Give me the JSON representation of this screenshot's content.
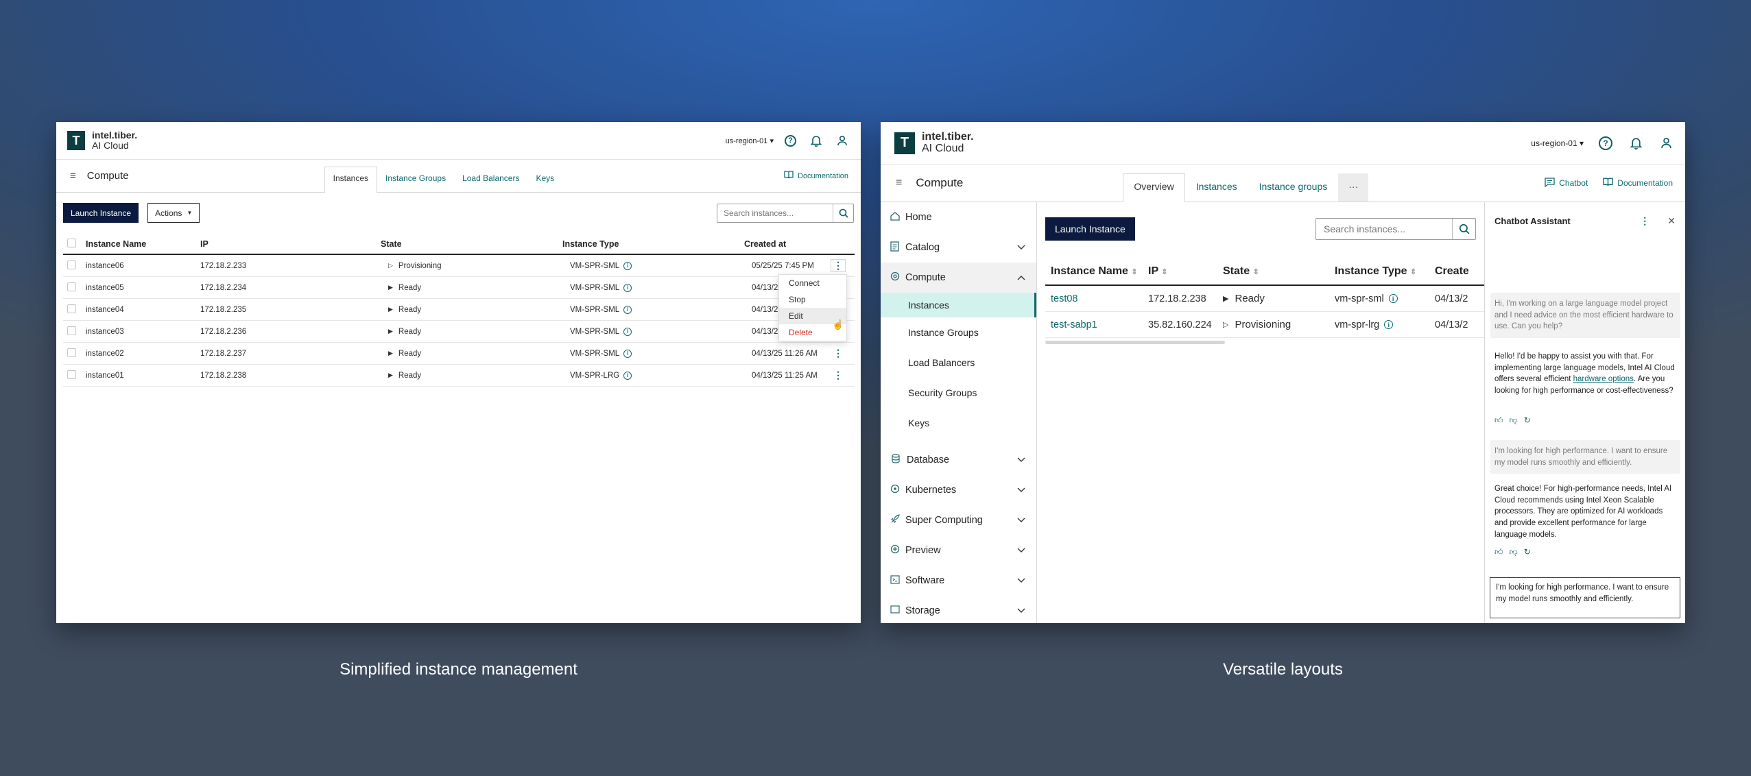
{
  "brand": {
    "line1": "intel.tiber.",
    "line2": "AI Cloud",
    "mark": "T"
  },
  "left": {
    "region": "us-region-01 ▾",
    "page_title": "Compute",
    "tabs": [
      {
        "label": "Instances"
      },
      {
        "label": "Instance Groups"
      },
      {
        "label": "Load Balancers"
      },
      {
        "label": "Keys"
      }
    ],
    "documentation": "Documentation",
    "launch_label": "Launch Instance",
    "actions_label": "Actions",
    "search_placeholder": "Search instances...",
    "columns": {
      "name": "Instance Name",
      "ip": "IP",
      "state": "State",
      "type": "Instance Type",
      "created": "Created at"
    },
    "rows": [
      {
        "name": "instance06",
        "ip": "172.18.2.233",
        "state": "Provisioning",
        "type": "VM-SPR-SML",
        "created": "05/25/25 7:45 PM"
      },
      {
        "name": "instance05",
        "ip": "172.18.2.234",
        "state": "Ready",
        "type": "VM-SPR-SML",
        "created": "04/13/2"
      },
      {
        "name": "instance04",
        "ip": "172.18.2.235",
        "state": "Ready",
        "type": "VM-SPR-SML",
        "created": "04/13/2"
      },
      {
        "name": "instance03",
        "ip": "172.18.2.236",
        "state": "Ready",
        "type": "VM-SPR-SML",
        "created": "04/13/2"
      },
      {
        "name": "instance02",
        "ip": "172.18.2.237",
        "state": "Ready",
        "type": "VM-SPR-SML",
        "created": "04/13/25 11:26 AM"
      },
      {
        "name": "instance01",
        "ip": "172.18.2.238",
        "state": "Ready",
        "type": "VM-SPR-LRG",
        "created": "04/13/25 11:25 AM"
      }
    ],
    "menu": {
      "connect": "Connect",
      "stop": "Stop",
      "edit": "Edit",
      "delete": "Delete"
    }
  },
  "right": {
    "region": "us-region-01 ▾",
    "page_title": "Compute",
    "tabs": [
      {
        "label": "Overview"
      },
      {
        "label": "Instances"
      },
      {
        "label": "Instance groups"
      },
      {
        "label": "···"
      }
    ],
    "chatbot": "Chatbot",
    "documentation": "Documentation",
    "sidebar": {
      "home": "Home",
      "catalog": "Catalog",
      "compute": "Compute",
      "sub": [
        "Instances",
        "Instance Groups",
        "Load Balancers",
        "Security Groups",
        "Keys"
      ],
      "database": "Database",
      "kubernetes": "Kubernetes",
      "super": "Super Computing",
      "preview": "Preview",
      "software": "Software",
      "storage": "Storage"
    },
    "launch_label": "Launch Instance",
    "search_placeholder": "Search instances...",
    "columns": {
      "name": "Instance Name",
      "ip": "IP",
      "state": "State",
      "type": "Instance Type",
      "created": "Create"
    },
    "rows": [
      {
        "name": "test08",
        "ip": "172.18.2.238",
        "state": "Ready",
        "type": "vm-spr-sml",
        "created": "04/13/2"
      },
      {
        "name": "test-sabp1",
        "ip": "35.82.160.224",
        "state": "Provisioning",
        "type": "vm-spr-lrg",
        "created": "04/13/2"
      }
    ],
    "chat": {
      "title": "Chatbot Assistant",
      "m1": "Hi, I'm working on a large language model project and I need advice on the most efficient hardware to use. Can you help?",
      "r1_pre": "Hello! I'd be happy to assist you with that. For implementing large language models, Intel AI Cloud offers several efficient ",
      "r1_link": "hardware options",
      "r1_post": ". Are you looking for high performance or cost-effectiveness?",
      "m2": "I'm looking for high performance. I want to ensure my model runs smoothly and efficiently.",
      "r2": "Great choice! For high-performance needs, Intel AI Cloud recommends using Intel Xeon Scalable processors. They are optimized for AI workloads and provide excellent performance for large language models.",
      "input": "I'm looking for high performance. I want to ensure my model runs smoothly and efficiently."
    }
  },
  "captions": {
    "left": "Simplified instance management",
    "right": "Versatile layouts"
  }
}
